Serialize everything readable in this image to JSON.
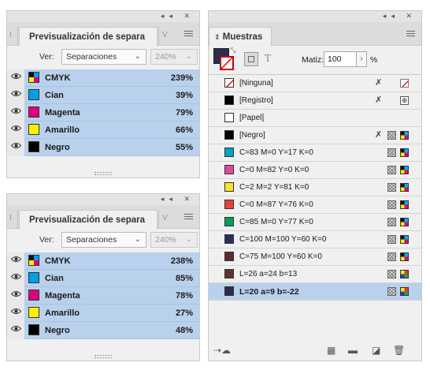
{
  "sep_panels": [
    {
      "title": "Previsualización de separa",
      "view_label": "Ver:",
      "view_value": "Separaciones",
      "zoom": "240%",
      "rows": [
        {
          "name": "CMYK",
          "percent": "239%",
          "color": "cmyk"
        },
        {
          "name": "Cian",
          "percent": "39%",
          "color": "#00a0e3"
        },
        {
          "name": "Magenta",
          "percent": "79%",
          "color": "#e0007a"
        },
        {
          "name": "Amarillo",
          "percent": "66%",
          "color": "#ffee00"
        },
        {
          "name": "Negro",
          "percent": "55%",
          "color": "#000000"
        }
      ]
    },
    {
      "title": "Previsualización de separa",
      "view_label": "Ver:",
      "view_value": "Separaciones",
      "zoom": "240%",
      "rows": [
        {
          "name": "CMYK",
          "percent": "238%",
          "color": "cmyk"
        },
        {
          "name": "Cian",
          "percent": "85%",
          "color": "#00a0e3"
        },
        {
          "name": "Magenta",
          "percent": "78%",
          "color": "#e0007a"
        },
        {
          "name": "Amarillo",
          "percent": "27%",
          "color": "#ffee00"
        },
        {
          "name": "Negro",
          "percent": "48%",
          "color": "#000000"
        }
      ]
    }
  ],
  "swatches": {
    "title": "Muestras",
    "tint_label": "Matiz:",
    "tint_value": "100",
    "tint_unit": "%",
    "fill_color": "#2b2d4f",
    "items": [
      {
        "label": "[Ninguna]",
        "color": "none",
        "icons": [
          "lock",
          "none"
        ]
      },
      {
        "label": "[Registro]",
        "color": "#000000",
        "icons": [
          "lock",
          "registration"
        ]
      },
      {
        "label": "[Papel]",
        "color": "#ffffff",
        "icons": []
      },
      {
        "label": "[Negro]",
        "color": "#000000",
        "icons": [
          "lock",
          "process",
          "cmyk"
        ]
      },
      {
        "label": "C=83 M=0 Y=17 K=0",
        "color": "#00a3c8",
        "icons": [
          "process",
          "cmyk"
        ]
      },
      {
        "label": "C=0 M=82 Y=0 K=0",
        "color": "#e5489a",
        "icons": [
          "process",
          "cmyk"
        ]
      },
      {
        "label": "C=2 M=2 Y=81 K=0",
        "color": "#fbe12c",
        "icons": [
          "process",
          "cmyk"
        ]
      },
      {
        "label": "C=0 M=87 Y=76 K=0",
        "color": "#e8413a",
        "icons": [
          "process",
          "cmyk"
        ]
      },
      {
        "label": "C=85 M=0 Y=77 K=0",
        "color": "#00a05a",
        "icons": [
          "process",
          "cmyk"
        ]
      },
      {
        "label": "C=100 M=100 Y=60 K=0",
        "color": "#2e2c5e",
        "icons": [
          "process",
          "cmyk"
        ]
      },
      {
        "label": "C=75 M=100 Y=60 K=0",
        "color": "#5e2a2d",
        "icons": [
          "process",
          "cmyk"
        ]
      },
      {
        "label": "L=26 a=24 b=13",
        "color": "#5c3330",
        "icons": [
          "process",
          "lab"
        ]
      },
      {
        "label": "L=20 a=9 b=-22",
        "color": "#2b2d4f",
        "icons": [
          "process",
          "lab"
        ],
        "selected": true
      }
    ]
  }
}
